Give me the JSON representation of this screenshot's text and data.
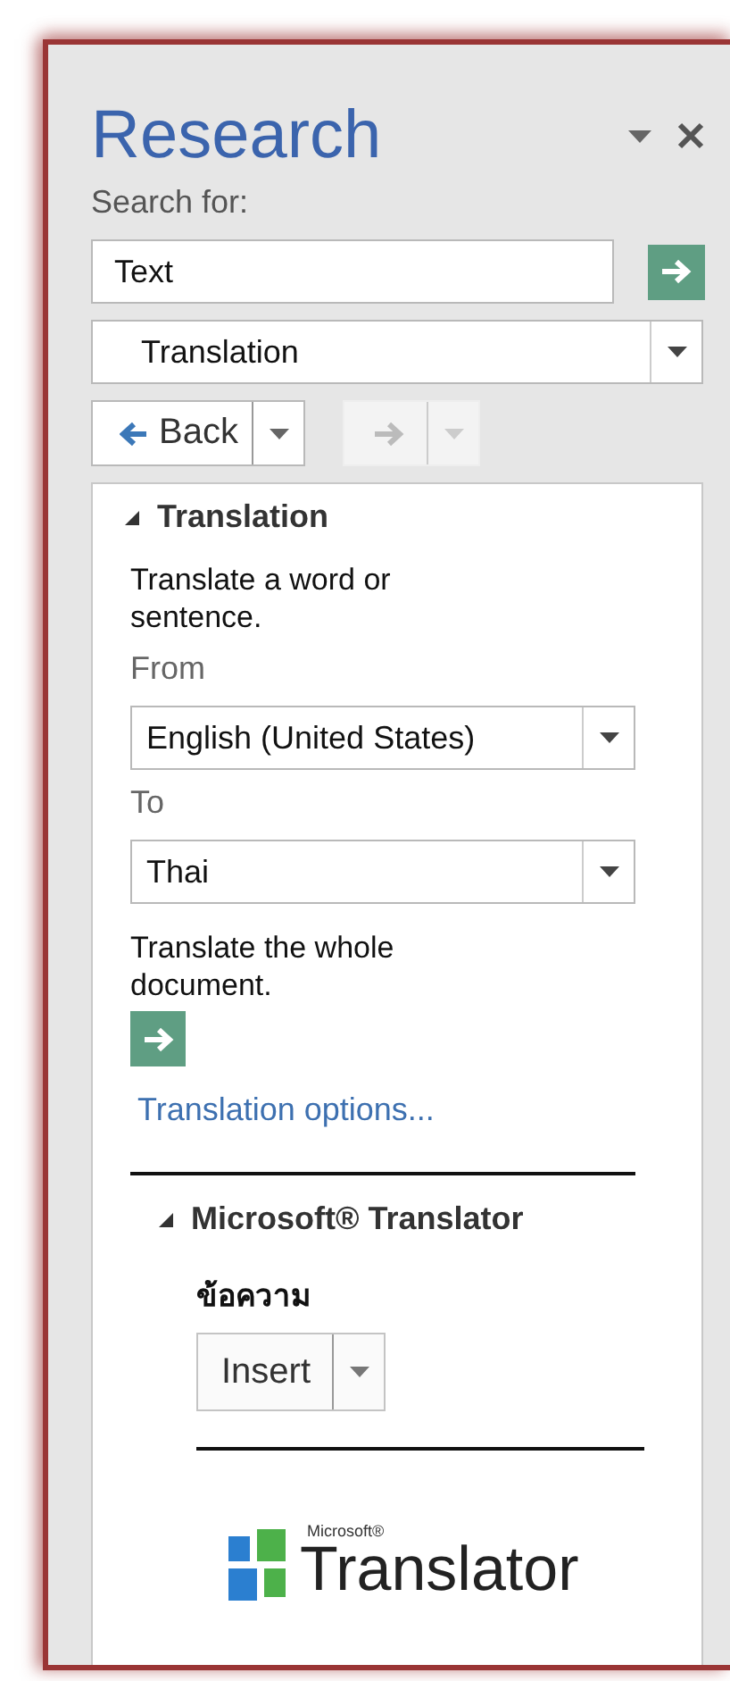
{
  "pane": {
    "title": "Research"
  },
  "search": {
    "label": "Search for:",
    "value": "Text"
  },
  "source": {
    "value": "Translation"
  },
  "nav": {
    "back": {
      "label": "Back",
      "disabled": false
    },
    "forward": {
      "disabled": true
    }
  },
  "translation": {
    "title": "Translation",
    "expanded": true,
    "intro": "Translate a word or sentence.",
    "from_label": "From",
    "from_value": "English (United States)",
    "to_label": "To",
    "to_value": "Thai",
    "document_text": "Translate the whole document.",
    "options_link": "Translation options..."
  },
  "translator": {
    "title": "Microsoft® Translator",
    "expanded": true,
    "result": "ข้อความ",
    "insert_label": "Insert",
    "logo_small": "Microsoft®",
    "logo_text": "Translator"
  }
}
